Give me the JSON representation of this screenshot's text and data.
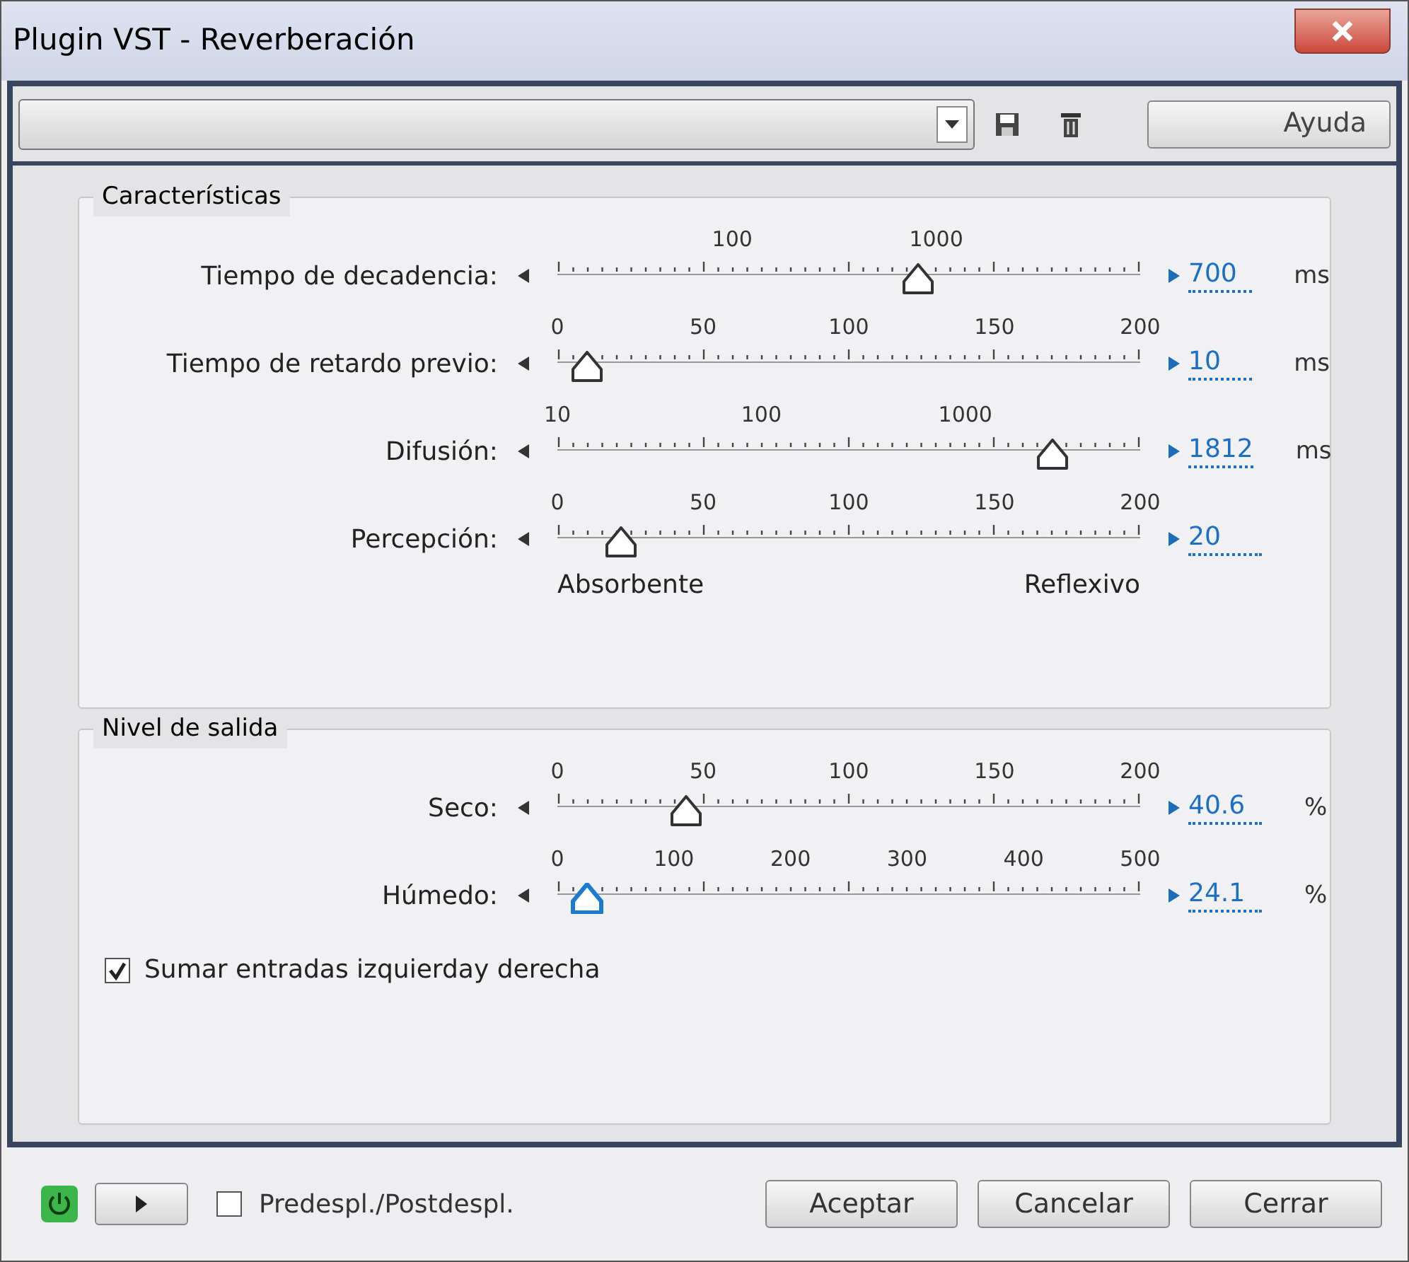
{
  "window": {
    "title": "Plugin VST - Reverberación"
  },
  "toolbar": {
    "help_button": "Ayuda"
  },
  "groups": [
    {
      "title": "Características",
      "sliders": [
        {
          "label": "Tiempo de decadencia:",
          "kind": "log",
          "ticks": [
            "100",
            "1000"
          ],
          "level": 0.62,
          "value": "700",
          "unit": "ms",
          "focused": false
        },
        {
          "label": "Tiempo de retardo previo:",
          "kind": "linear",
          "ticks": [
            "0",
            "50",
            "100",
            "150",
            "200"
          ],
          "level": 0.05,
          "value": "10",
          "unit": "ms",
          "focused": false
        },
        {
          "label": "Difusión:",
          "kind": "log",
          "ticks": [
            "10",
            "100",
            "1000"
          ],
          "level": 0.85,
          "value": "1812",
          "unit": "ms",
          "focused": false
        },
        {
          "label": "Percepción:",
          "kind": "linear",
          "ticks": [
            "0",
            "50",
            "100",
            "150",
            "200"
          ],
          "level": 0.11,
          "value": "20",
          "min_label": "Absorbente",
          "max_label": "Reflexivo",
          "focused": false
        }
      ]
    },
    {
      "title": "Nivel de salida",
      "sliders": [
        {
          "label": "Seco:",
          "kind": "linear",
          "ticks": [
            "0",
            "50",
            "100",
            "150",
            "200"
          ],
          "level": 0.22,
          "value": "40.6",
          "unit": "%",
          "focused": false
        },
        {
          "label": "Húmedo:",
          "kind": "linear",
          "ticks": [
            "0",
            "100",
            "200",
            "300",
            "400",
            "500"
          ],
          "level": 0.05,
          "value": "24.1",
          "unit": "%",
          "focused": true
        }
      ],
      "checkbox": {
        "label": "Sumar entradas izquierday derecha",
        "checked": true
      }
    }
  ],
  "footer": {
    "power_on": true,
    "pre_post": {
      "label": "Predespl./Postdespl.",
      "checked": false
    },
    "buttons": [
      "Aceptar",
      "Cancelar",
      "Cerrar"
    ]
  }
}
